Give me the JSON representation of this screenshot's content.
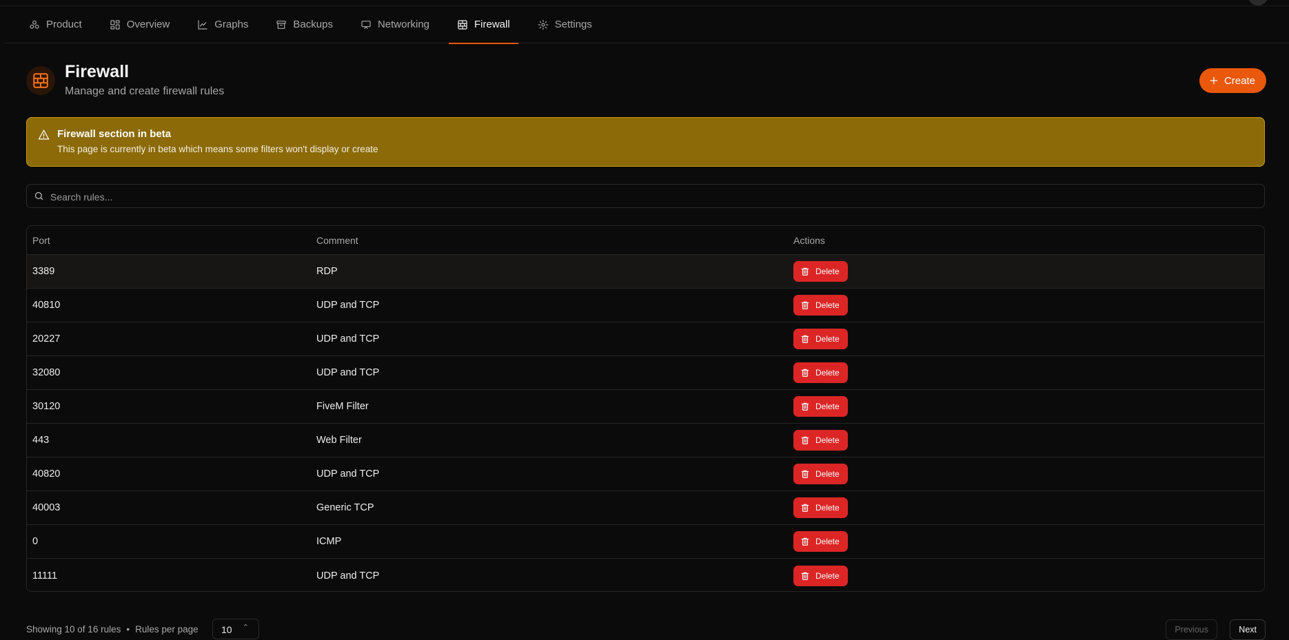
{
  "tabs": [
    {
      "label": "Product",
      "icon": "product-icon"
    },
    {
      "label": "Overview",
      "icon": "overview-icon"
    },
    {
      "label": "Graphs",
      "icon": "graph-icon"
    },
    {
      "label": "Backups",
      "icon": "archive-icon"
    },
    {
      "label": "Networking",
      "icon": "network-icon"
    },
    {
      "label": "Firewall",
      "icon": "firewall-icon",
      "active": true
    },
    {
      "label": "Settings",
      "icon": "gear-icon"
    }
  ],
  "header": {
    "title": "Firewall",
    "subtitle": "Manage and create firewall rules",
    "create_label": "Create",
    "accent": "#ea580c"
  },
  "alert": {
    "title": "Firewall section in beta",
    "message": "This page is currently in beta which means some filters won't display or create",
    "color": "#8b6a07"
  },
  "search": {
    "placeholder": "Search rules...",
    "value": ""
  },
  "table": {
    "columns": [
      "Port",
      "Comment",
      "Actions"
    ],
    "delete_label": "Delete",
    "rows": [
      {
        "port": "3389",
        "comment": "RDP"
      },
      {
        "port": "40810",
        "comment": "UDP and TCP"
      },
      {
        "port": "20227",
        "comment": "UDP and TCP"
      },
      {
        "port": "32080",
        "comment": "UDP and TCP"
      },
      {
        "port": "30120",
        "comment": "FiveM Filter"
      },
      {
        "port": "443",
        "comment": "Web Filter"
      },
      {
        "port": "40820",
        "comment": "UDP and TCP"
      },
      {
        "port": "40003",
        "comment": "Generic TCP"
      },
      {
        "port": "0",
        "comment": "ICMP"
      },
      {
        "port": "11111",
        "comment": "UDP and TCP"
      }
    ]
  },
  "footer": {
    "showing": "Showing 10 of 16 rules",
    "separator": "•",
    "per_page_label": "Rules per page",
    "per_page_value": "10",
    "previous_label": "Previous",
    "next_label": "Next"
  }
}
